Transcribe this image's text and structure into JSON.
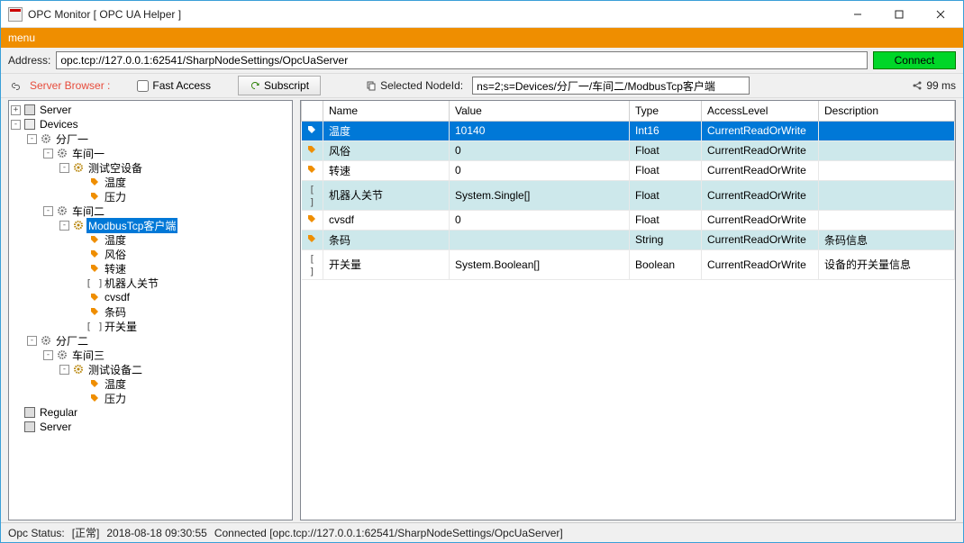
{
  "window": {
    "title": "OPC Monitor [ OPC UA Helper ]"
  },
  "menu": {
    "label": "menu"
  },
  "address": {
    "label": "Address:",
    "value": "opc.tcp://127.0.0.1:62541/SharpNodeSettings/OpcUaServer",
    "connect": "Connect"
  },
  "toolbar": {
    "server_browser": "Server Browser :",
    "fast_access": "Fast Access",
    "subscript": "Subscript",
    "selected_nodeid": "Selected NodeId:",
    "nodeid_value": "ns=2;s=Devices/分厂一/车间二/ModbusTcp客户端",
    "latency": "99 ms"
  },
  "tree": {
    "server": "Server",
    "devices": "Devices",
    "factory1": "分厂一",
    "workshop1": "车间一",
    "test_empty_device": "测试空设备",
    "temp": "温度",
    "pressure": "压力",
    "workshop2": "车间二",
    "modbus": "ModbusTcp客户端",
    "fengsu": "风俗",
    "zhuansu": "转速",
    "robot_joint": "机器人关节",
    "cvsdf": "cvsdf",
    "barcode": "条码",
    "switch": "开关量",
    "factory2": "分厂二",
    "workshop3": "车间三",
    "test_device2": "测试设备二",
    "regular": "Regular",
    "server2": "Server"
  },
  "table": {
    "headers": {
      "name": "Name",
      "value": "Value",
      "type": "Type",
      "access": "AccessLevel",
      "desc": "Description"
    },
    "rows": [
      {
        "icon": "tag",
        "name": "温度",
        "value": "10140",
        "type": "Int16",
        "access": "CurrentReadOrWrite",
        "desc": "",
        "sel": true
      },
      {
        "icon": "tag",
        "name": "风俗",
        "value": "0",
        "type": "Float",
        "access": "CurrentReadOrWrite",
        "desc": "",
        "alt": true
      },
      {
        "icon": "tag",
        "name": "转速",
        "value": "0",
        "type": "Float",
        "access": "CurrentReadOrWrite",
        "desc": ""
      },
      {
        "icon": "brackets",
        "name": "机器人关节",
        "value": "System.Single[]",
        "type": "Float",
        "access": "CurrentReadOrWrite",
        "desc": "",
        "alt": true
      },
      {
        "icon": "tag",
        "name": "cvsdf",
        "value": "0",
        "type": "Float",
        "access": "CurrentReadOrWrite",
        "desc": ""
      },
      {
        "icon": "tag",
        "name": "条码",
        "value": "",
        "type": "String",
        "access": "CurrentReadOrWrite",
        "desc": "条码信息",
        "alt": true
      },
      {
        "icon": "brackets",
        "name": "开关量",
        "value": "System.Boolean[]",
        "type": "Boolean",
        "access": "CurrentReadOrWrite",
        "desc": "设备的开关量信息"
      }
    ]
  },
  "status": {
    "label": "Opc Status:",
    "state": "[正常]",
    "time": "2018-08-18 09:30:55",
    "msg": "Connected [opc.tcp://127.0.0.1:62541/SharpNodeSettings/OpcUaServer]"
  }
}
